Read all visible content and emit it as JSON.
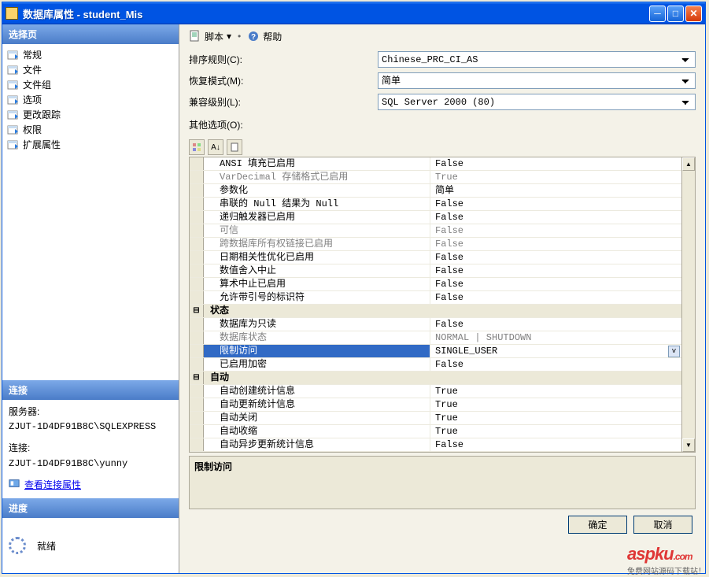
{
  "title": "数据库属性 - student_Mis",
  "sidebar": {
    "header_select": "选择页",
    "items": [
      {
        "label": "常规"
      },
      {
        "label": "文件"
      },
      {
        "label": "文件组"
      },
      {
        "label": "选项"
      },
      {
        "label": "更改跟踪"
      },
      {
        "label": "权限"
      },
      {
        "label": "扩展属性"
      }
    ],
    "header_conn": "连接",
    "server_label": "服务器:",
    "server_value": "ZJUT-1D4DF91B8C\\SQLEXPRESS",
    "conn_label": "连接:",
    "conn_value": "ZJUT-1D4DF91B8C\\yunny",
    "view_props": "查看连接属性",
    "header_progress": "进度",
    "progress_status": "就绪"
  },
  "toolbar": {
    "script": "脚本",
    "help": "帮助"
  },
  "form": {
    "collation_label": "排序规则(C):",
    "collation_value": "Chinese_PRC_CI_AS",
    "recovery_label": "恢复模式(M):",
    "recovery_value": "简单",
    "compat_label": "兼容级别(L):",
    "compat_value": "SQL Server 2000 (80)",
    "other_label": "其他选项(O):"
  },
  "grid": [
    {
      "type": "row",
      "indent": true,
      "prop": "ANSI 填充已启用",
      "val": "False"
    },
    {
      "type": "row",
      "indent": true,
      "disabled": true,
      "prop": "VarDecimal 存储格式已启用",
      "val": "True"
    },
    {
      "type": "row",
      "indent": true,
      "prop": "参数化",
      "val": "简单"
    },
    {
      "type": "row",
      "indent": true,
      "prop": "串联的 Null 结果为 Null",
      "val": "False"
    },
    {
      "type": "row",
      "indent": true,
      "prop": "递归触发器已启用",
      "val": "False"
    },
    {
      "type": "row",
      "indent": true,
      "disabled": true,
      "prop": "可信",
      "val": "False"
    },
    {
      "type": "row",
      "indent": true,
      "disabled": true,
      "prop": "跨数据库所有权链接已启用",
      "val": "False"
    },
    {
      "type": "row",
      "indent": true,
      "prop": "日期相关性优化已启用",
      "val": "False"
    },
    {
      "type": "row",
      "indent": true,
      "prop": "数值舍入中止",
      "val": "False"
    },
    {
      "type": "row",
      "indent": true,
      "prop": "算术中止已启用",
      "val": "False"
    },
    {
      "type": "row",
      "indent": true,
      "prop": "允许带引号的标识符",
      "val": "False"
    },
    {
      "type": "cat",
      "prop": "状态",
      "val": ""
    },
    {
      "type": "row",
      "indent": true,
      "prop": "数据库为只读",
      "val": "False"
    },
    {
      "type": "row",
      "indent": true,
      "disabled": true,
      "prop": "数据库状态",
      "val": "NORMAL | SHUTDOWN"
    },
    {
      "type": "row",
      "indent": true,
      "selected": true,
      "prop": "限制访问",
      "val": "SINGLE_USER"
    },
    {
      "type": "row",
      "indent": true,
      "prop": "已启用加密",
      "val": "False"
    },
    {
      "type": "cat",
      "prop": "自动",
      "val": ""
    },
    {
      "type": "row",
      "indent": true,
      "prop": "自动创建统计信息",
      "val": "True"
    },
    {
      "type": "row",
      "indent": true,
      "prop": "自动更新统计信息",
      "val": "True"
    },
    {
      "type": "row",
      "indent": true,
      "prop": "自动关闭",
      "val": "True"
    },
    {
      "type": "row",
      "indent": true,
      "prop": "自动收缩",
      "val": "True"
    },
    {
      "type": "row",
      "indent": true,
      "prop": "自动异步更新统计信息",
      "val": "False"
    }
  ],
  "desc_title": "限制访问",
  "buttons": {
    "ok": "确定",
    "cancel": "取消"
  },
  "watermark": {
    "brand": "aspku",
    "sub": "免费网站源码下载站！",
    "dom": ".com"
  }
}
